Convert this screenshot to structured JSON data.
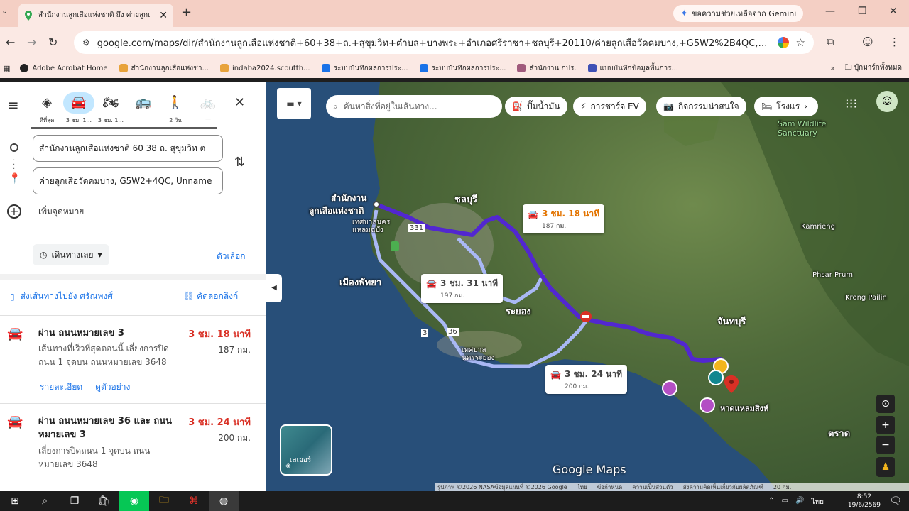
{
  "browser": {
    "tab_title": "สำนักงานลูกเสือแห่งชาติ ถึง ค่ายลูกเ",
    "gemini_label": "ขอความช่วยเหลือจาก Gemini",
    "url": "google.com/maps/dir/สำนักงานลูกเสือแห่งชาติ+60+38+ถ.+สุขุมวิท+ตำบล+บางพระ+อำเภอศรีราชา+ชลบุรี+20110/ค่ายลูกเสือวัดคมบาง,+G5W2%2B4QC,+Unnamed+Road...",
    "bookmarks": [
      {
        "label": "Adobe Acrobat Home",
        "color": "#222222"
      },
      {
        "label": "สำนักงานลูกเสือแห่งชา...",
        "color": "#e8a33b"
      },
      {
        "label": "indaba2024.scoutth...",
        "color": "#e8a33b"
      },
      {
        "label": "ระบบบันทึกผลการประ...",
        "color": "#1a73e8"
      },
      {
        "label": "ระบบบันทึกผลการประ...",
        "color": "#1a73e8"
      },
      {
        "label": "สำนักงาน กปร.",
        "color": "#a05a7c"
      },
      {
        "label": "แบบบันทึกข้อมูลพื้นการ...",
        "color": "#3f51b5"
      }
    ],
    "bookmarks_more": "»",
    "all_bookmarks": "บุ๊กมาร์กทั้งหมด"
  },
  "modes": [
    {
      "icon": "best-route-icon",
      "label": "ดีที่สุด"
    },
    {
      "icon": "car-icon",
      "label": "3 ชม. 1..."
    },
    {
      "icon": "motorcycle-icon",
      "label": "3 ชม. 1..."
    },
    {
      "icon": "transit-icon",
      "label": ""
    },
    {
      "icon": "walk-icon",
      "label": "2 วัน"
    },
    {
      "icon": "bike-icon",
      "label": "—"
    }
  ],
  "directions": {
    "origin": "สำนักงานลูกเสือแห่งชาติ 60 38 ถ. สุขุมวิท ต",
    "destination": "ค่ายลูกเสือวัดคมบาง, G5W2+4QC, Unname",
    "add_destination": "เพิ่มจุดหมาย",
    "depart": "เดินทางเลย",
    "options": "ตัวเลือก",
    "send_to_phone": "ส่งเส้นทางไปยัง ศรัณพงศ์",
    "copy_link": "คัดลอกลิงก์"
  },
  "routes": [
    {
      "title": "ผ่าน ถนนหมายเลข 3",
      "time": "3 ชม. 18 นาที",
      "distance": "187 กม.",
      "desc": "เส้นทางที่เร็วที่สุดตอนนี้ เลี่ยงการปิดถนน 1 จุดบน ถนนหมายเลข 3648",
      "details": "รายละเอียด",
      "preview": "ดูตัวอย่าง"
    },
    {
      "title": "ผ่าน ถนนหมายเลข 36 และ ถนนหมายเลข 3",
      "time": "3 ชม. 24 นาที",
      "distance": "200 กม.",
      "desc": "เลี่ยงการปิดถนน 1 จุดบน ถนนหมายเลข 3648"
    }
  ],
  "map": {
    "search_placeholder": "ค้นหาสิ่งที่อยู่ในเส้นทาง...",
    "chips": [
      "ปั๊มน้ำมัน",
      "การชาร์จ EV",
      "กิจกรรมน่าสนใจ",
      "โรงแร"
    ],
    "callouts": [
      {
        "time": "3 ชม. 18 นาที",
        "dist": "187 กม."
      },
      {
        "time": "3 ชม. 31 นาที",
        "dist": "197 กม."
      },
      {
        "time": "3 ชม. 24 นาที",
        "dist": "200 กม."
      }
    ],
    "labels": {
      "hq1": "สำนักงาน",
      "hq2": "ลูกเสือแห่งชาติ",
      "chonburi": "ชลบุรี",
      "pattaya": "เมืองพัทยา",
      "rayong": "ระยอง",
      "chanthaburi": "จันทบุรี",
      "trat": "ตราด",
      "laem_sing": "หาดแหลมสิงห์",
      "laem_chabang": "เทศบาลนคร แหลมฉบัง",
      "rayong_city": "เทศบาล นครระยอง",
      "wildlife": "Sam Wildlife Sanctuary",
      "kamrieng": "Kamrieng",
      "phsar_prum": "Phsar Prum",
      "krong_pailin": "Krong Pailin",
      "road_331": "331",
      "road_36": "36",
      "road_3": "3"
    },
    "layer_label": "เลเยอร์",
    "brand": "Google Maps",
    "watermark": "© 2026 Google",
    "attribution": [
      "รูปภาพ ©2026 NASAข้อมูลแผนที่ ©2026 Google",
      "ไทย",
      "ข้อกำหนด",
      "ความเป็นส่วนตัว",
      "ส่งความคิดเห็นเกี่ยวกับผลิตภัณฑ์",
      "20 กม."
    ]
  },
  "taskbar": {
    "lang": "ไทย",
    "time": "8:52",
    "date": "19/6/2569"
  }
}
